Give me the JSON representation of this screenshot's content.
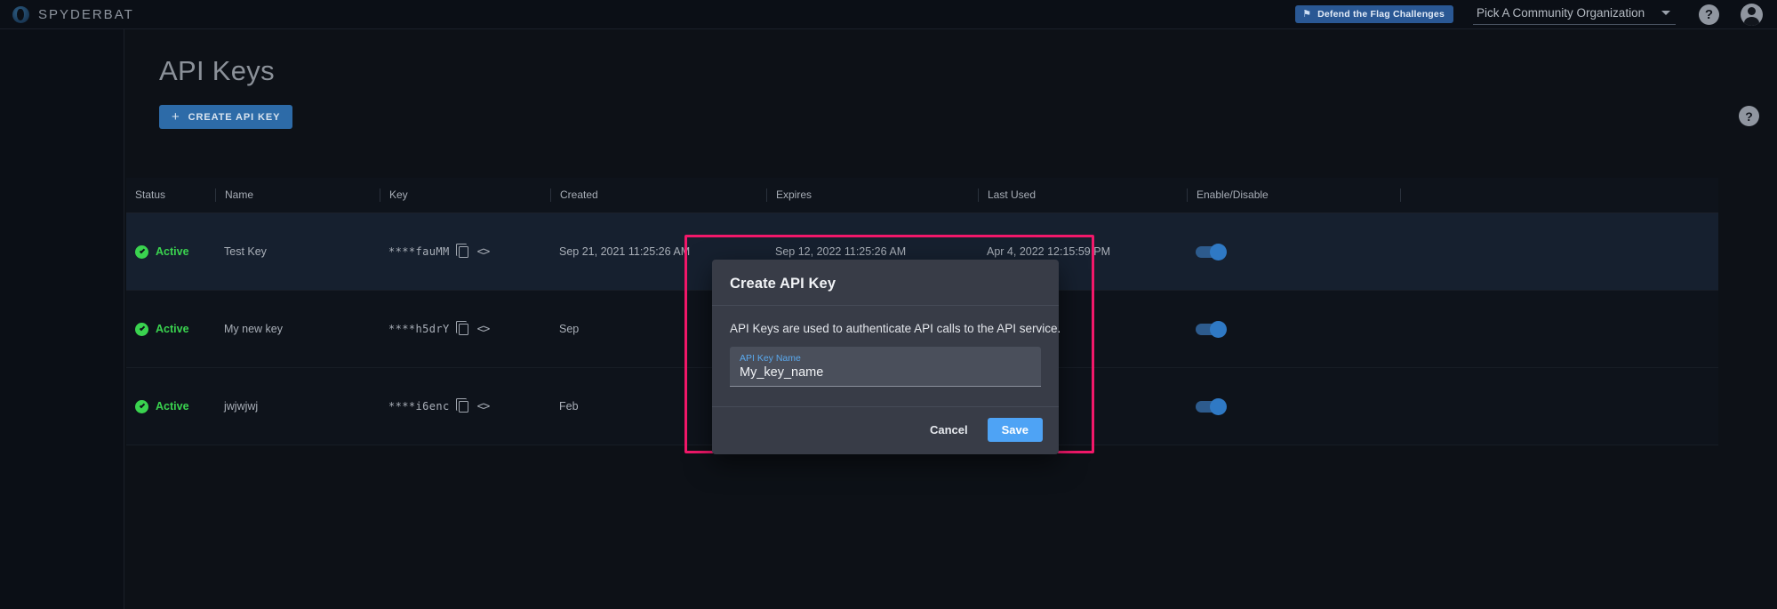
{
  "topbar": {
    "brand": "SPYDERBAT",
    "brand_icon": "spyderbat-logo-icon",
    "badge": {
      "label": "Defend the Flag Challenges",
      "icon": "flag-icon",
      "color": "#2a5894"
    },
    "org_picker": {
      "value": "Pick A Community Organization",
      "caret_icon": "chevron-down-icon"
    },
    "help_icon_label": "?",
    "avatar_icon": "user-avatar-icon"
  },
  "page": {
    "title": "API Keys",
    "create_button": {
      "label": "CREATE API KEY",
      "icon": "plus-icon"
    },
    "help_icon_label": "?"
  },
  "table": {
    "columns": [
      "Status",
      "Name",
      "Key",
      "Created",
      "Expires",
      "Last Used",
      "Enable/Disable",
      ""
    ],
    "rows": [
      {
        "status": "Active",
        "name": "Test Key",
        "key": "****fauMM",
        "created": "Sep 21, 2021 11:25:26 AM",
        "expires": "Sep 12, 2022 11:25:26 AM",
        "last_used": "Apr 4, 2022 12:15:59 PM",
        "enabled": true,
        "selected": true
      },
      {
        "status": "Active",
        "name": "My new key",
        "key": "****h5drY",
        "created": "Sep",
        "expires": "",
        "last_used": "",
        "enabled": true,
        "selected": false
      },
      {
        "status": "Active",
        "name": "jwjwjwj",
        "key": "****i6enc",
        "created": "Feb",
        "expires": "",
        "last_used": "",
        "enabled": true,
        "selected": false
      }
    ],
    "status_color": "#3ad34f",
    "copy_icon": "copy-icon",
    "code_icon": "code-brackets-icon"
  },
  "modal": {
    "title": "Create API Key",
    "description": "API Keys are used to authenticate API calls to the API service.",
    "field": {
      "label": "API Key Name",
      "value": "My_key_name",
      "placeholder": "API Key Name"
    },
    "cancel_label": "Cancel",
    "save_label": "Save",
    "accent_color": "#4ea3f5"
  },
  "annotation": {
    "color": "#f2186a"
  }
}
